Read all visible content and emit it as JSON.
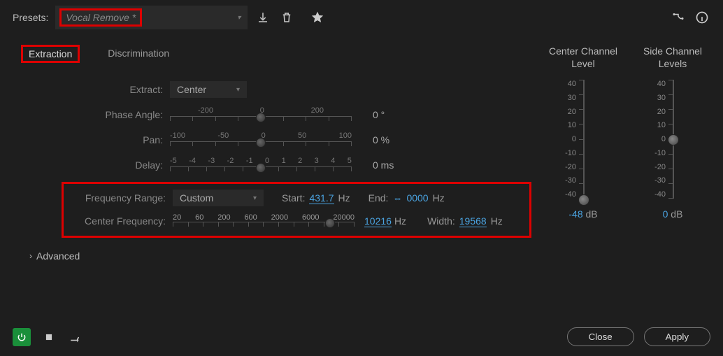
{
  "topbar": {
    "presets_label": "Presets:",
    "preset_value": "Vocal Remove *"
  },
  "tabs": {
    "extraction": "Extraction",
    "discrimination": "Discrimination"
  },
  "rows": {
    "extract_label": "Extract:",
    "extract_value": "Center",
    "phase_label": "Phase Angle:",
    "phase_ticks": [
      "-200",
      "0",
      "200"
    ],
    "phase_val": "0 °",
    "pan_label": "Pan:",
    "pan_ticks": [
      "-100",
      "-50",
      "0",
      "50",
      "100"
    ],
    "pan_val": "0 %",
    "delay_label": "Delay:",
    "delay_ticks": [
      "-5",
      "-4",
      "-3",
      "-2",
      "-1",
      "0",
      "1",
      "2",
      "3",
      "4",
      "5"
    ],
    "delay_val": "0 ms"
  },
  "freq": {
    "range_label": "Frequency Range:",
    "range_value": "Custom",
    "start_label": "Start:",
    "start_value": "431.7",
    "start_unit": "Hz",
    "end_label": "End:",
    "end_value": "0000",
    "end_unit": "Hz",
    "cf_label": "Center Frequency:",
    "cf_ticks": [
      "20",
      "60",
      "200",
      "600",
      "2000",
      "6000",
      "20000"
    ],
    "cf_value": "10216",
    "cf_unit": "Hz",
    "width_label": "Width:",
    "width_value": "19568",
    "width_unit": "Hz"
  },
  "advanced_label": "Advanced",
  "vsliders": {
    "center_title": "Center Channel Level",
    "side_title": "Side Channel Levels",
    "ticks": [
      "40",
      "30",
      "20",
      "10",
      "0",
      "-10",
      "-20",
      "-30",
      "-40"
    ],
    "center_db": "-48",
    "side_db": "0",
    "db_unit": "dB"
  },
  "buttons": {
    "close": "Close",
    "apply": "Apply"
  }
}
